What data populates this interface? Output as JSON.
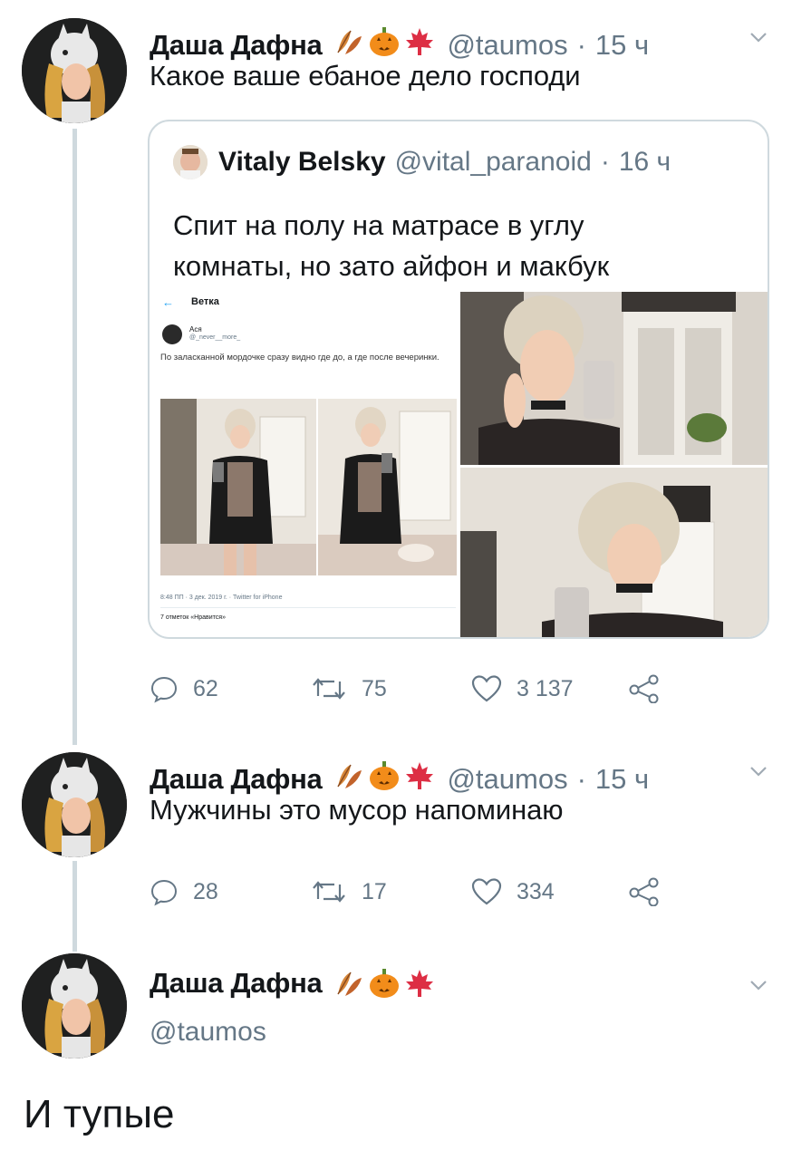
{
  "tweets": [
    {
      "author": "Даша Дафна",
      "handle": "@taumos",
      "separator": "·",
      "time": "15 ч",
      "text": "Какое ваше ебаное дело господи",
      "quote": {
        "author": "Vitaly Belsky",
        "handle": "@vital_paranoid",
        "separator": "·",
        "time": "16 ч",
        "text_lines": [
          "Спит на полу на матрасе в углу",
          "комнаты, но зато айфон и макбук"
        ],
        "screenshot": {
          "back": "←",
          "title": "Ветка",
          "name": "Ася",
          "handle": "@_never__more_",
          "text": "По заласканной мордочке сразу видно где до, а где после вечеринки.",
          "meta": "8:48 ПП · 3 дек. 2019 г. · Twitter for iPhone",
          "stats": "7 отметок «Нравится»"
        }
      },
      "replies": "62",
      "retweets": "75",
      "likes": "3 137"
    },
    {
      "author": "Даша Дафна",
      "handle": "@taumos",
      "separator": "·",
      "time": "15 ч",
      "text": "Мужчины это мусор напоминаю",
      "replies": "28",
      "retweets": "17",
      "likes": "334"
    },
    {
      "author": "Даша Дафна",
      "handle": "@taumos",
      "text": "И тупые"
    }
  ],
  "icons": [
    "leaves-emoji",
    "pumpkin-emoji",
    "maple-leaf-emoji",
    "chevron-down-icon",
    "reply-icon",
    "retweet-icon",
    "like-icon",
    "share-icon"
  ],
  "colors": {
    "secondary_text": "#657786",
    "border": "#cfd9de",
    "text": "#14171a"
  }
}
